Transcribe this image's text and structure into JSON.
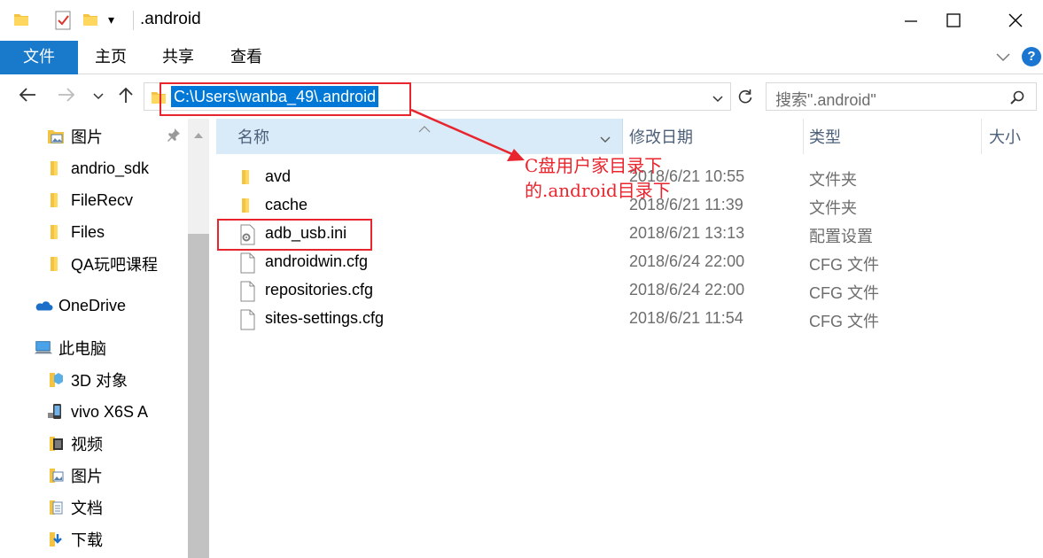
{
  "window": {
    "title": ".android",
    "quick_access_dropdown": "▾",
    "minimize": "—",
    "maximize": "☐",
    "close": "✕"
  },
  "ribbon": {
    "tabs": [
      {
        "label": "文件",
        "active": true
      },
      {
        "label": "主页"
      },
      {
        "label": "共享"
      },
      {
        "label": "查看"
      }
    ],
    "help": "?",
    "accent_color": "#1979ca"
  },
  "navigation": {
    "address": "C:\\Users\\wanba_49\\.android",
    "search_placeholder": "搜索\".android\""
  },
  "nav_pane": {
    "items": [
      {
        "label": "图片",
        "icon": "pictures-folder-icon",
        "pinned": true
      },
      {
        "label": "andrio_sdk",
        "icon": "folder-icon"
      },
      {
        "label": "FileRecv",
        "icon": "folder-icon"
      },
      {
        "label": "Files",
        "icon": "folder-icon"
      },
      {
        "label": "QA玩吧课程",
        "icon": "folder-icon"
      },
      {
        "label": "OneDrive",
        "icon": "onedrive-cloud-icon"
      },
      {
        "label": "此电脑",
        "icon": "this-pc-icon"
      },
      {
        "label": "3D 对象",
        "icon": "3d-objects-folder-icon"
      },
      {
        "label": "vivo X6S A",
        "icon": "phone-icon"
      },
      {
        "label": "视频",
        "icon": "videos-folder-icon"
      },
      {
        "label": "图片",
        "icon": "pictures-folder-icon"
      },
      {
        "label": "文档",
        "icon": "documents-folder-icon"
      },
      {
        "label": "下载",
        "icon": "downloads-folder-icon"
      }
    ]
  },
  "file_list": {
    "columns": {
      "name": "名称",
      "date": "修改日期",
      "type": "类型",
      "size": "大小"
    },
    "rows": [
      {
        "name": "avd",
        "date": "2018/6/21 10:55",
        "type": "文件夹",
        "icon": "folder-icon"
      },
      {
        "name": "cache",
        "date": "2018/6/21 11:39",
        "type": "文件夹",
        "icon": "folder-icon"
      },
      {
        "name": "adb_usb.ini",
        "date": "2018/6/21 13:13",
        "type": "配置设置",
        "icon": "config-file-icon"
      },
      {
        "name": "androidwin.cfg",
        "date": "2018/6/24 22:00",
        "type": "CFG 文件",
        "icon": "file-icon"
      },
      {
        "name": "repositories.cfg",
        "date": "2018/6/24 22:00",
        "type": "CFG 文件",
        "icon": "file-icon"
      },
      {
        "name": "sites-settings.cfg",
        "date": "2018/6/21 11:54",
        "type": "CFG 文件",
        "icon": "file-icon"
      }
    ]
  },
  "annotation": {
    "line1": "C盘用户家目录下",
    "line2": "的.android目录下",
    "color": "#e8242d"
  }
}
